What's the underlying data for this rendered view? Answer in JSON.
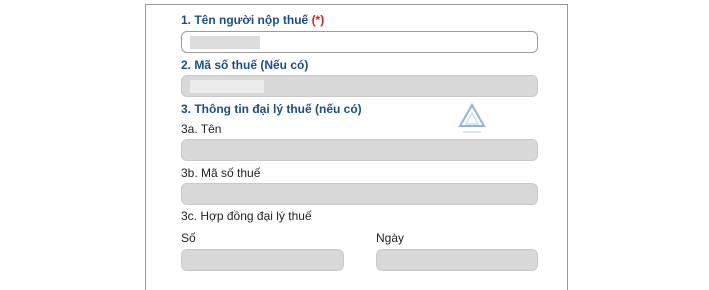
{
  "form": {
    "taxpayer_name": {
      "label": "1. Tên người nộp thuế",
      "required_mark": "(*)",
      "value": ""
    },
    "tax_code": {
      "label": "2. Mã số thuế (Nếu có)",
      "value": ""
    },
    "agent_section": {
      "label": "3. Thông tin đại lý thuế (nếu có)"
    },
    "agent_name": {
      "label": "3a. Tên",
      "value": ""
    },
    "agent_tax_code": {
      "label": "3b. Mã số thuế",
      "value": ""
    },
    "agent_contract": {
      "label": "3c. Hợp đồng đại lý thuế"
    },
    "contract_number": {
      "label": "Số",
      "value": ""
    },
    "contract_date": {
      "label": "Ngày",
      "value": ""
    }
  },
  "colors": {
    "label_blue": "#1a4e8a",
    "required_red": "#e02020",
    "disabled_field": "#d8d8d8",
    "enabled_field_border": "#9c9c9c"
  },
  "icons": {
    "watermark": "triangle-logo-icon"
  }
}
